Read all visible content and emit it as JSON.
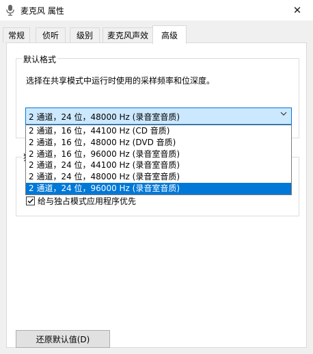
{
  "window": {
    "title": "麦克风 属性",
    "icon": "microphone-icon",
    "close": "✕"
  },
  "tabs": [
    {
      "label": "常规"
    },
    {
      "label": "侦听"
    },
    {
      "label": "级别"
    },
    {
      "label": "麦克风声效"
    },
    {
      "label": "高级",
      "active": true
    }
  ],
  "default_format": {
    "group_label": "默认格式",
    "description": "选择在共享模式中运行时使用的采样频率和位深度。",
    "selected": "2 通道，24 位，48000 Hz (录音室音质)",
    "options": [
      "2 通道，16 位，44100 Hz (CD 音质)",
      "2 通道，16 位，48000 Hz (DVD 音质)",
      "2 通道，16 位，96000 Hz (录音室音质)",
      "2 通道，24 位，44100 Hz (录音室音质)",
      "2 通道，24 位，48000 Hz (录音室音质)",
      "2 通道，24 位，96000 Hz (录音室音质)"
    ],
    "highlighted_option_index": 5
  },
  "exclusive": {
    "group_label_visible": "独",
    "checkbox_label": "给与独占模式应用程序优先",
    "checked": true
  },
  "restore_button": "还原默认值(D)",
  "colors": {
    "accent": "#0078d7",
    "combo_bg": "#cce8ff"
  }
}
